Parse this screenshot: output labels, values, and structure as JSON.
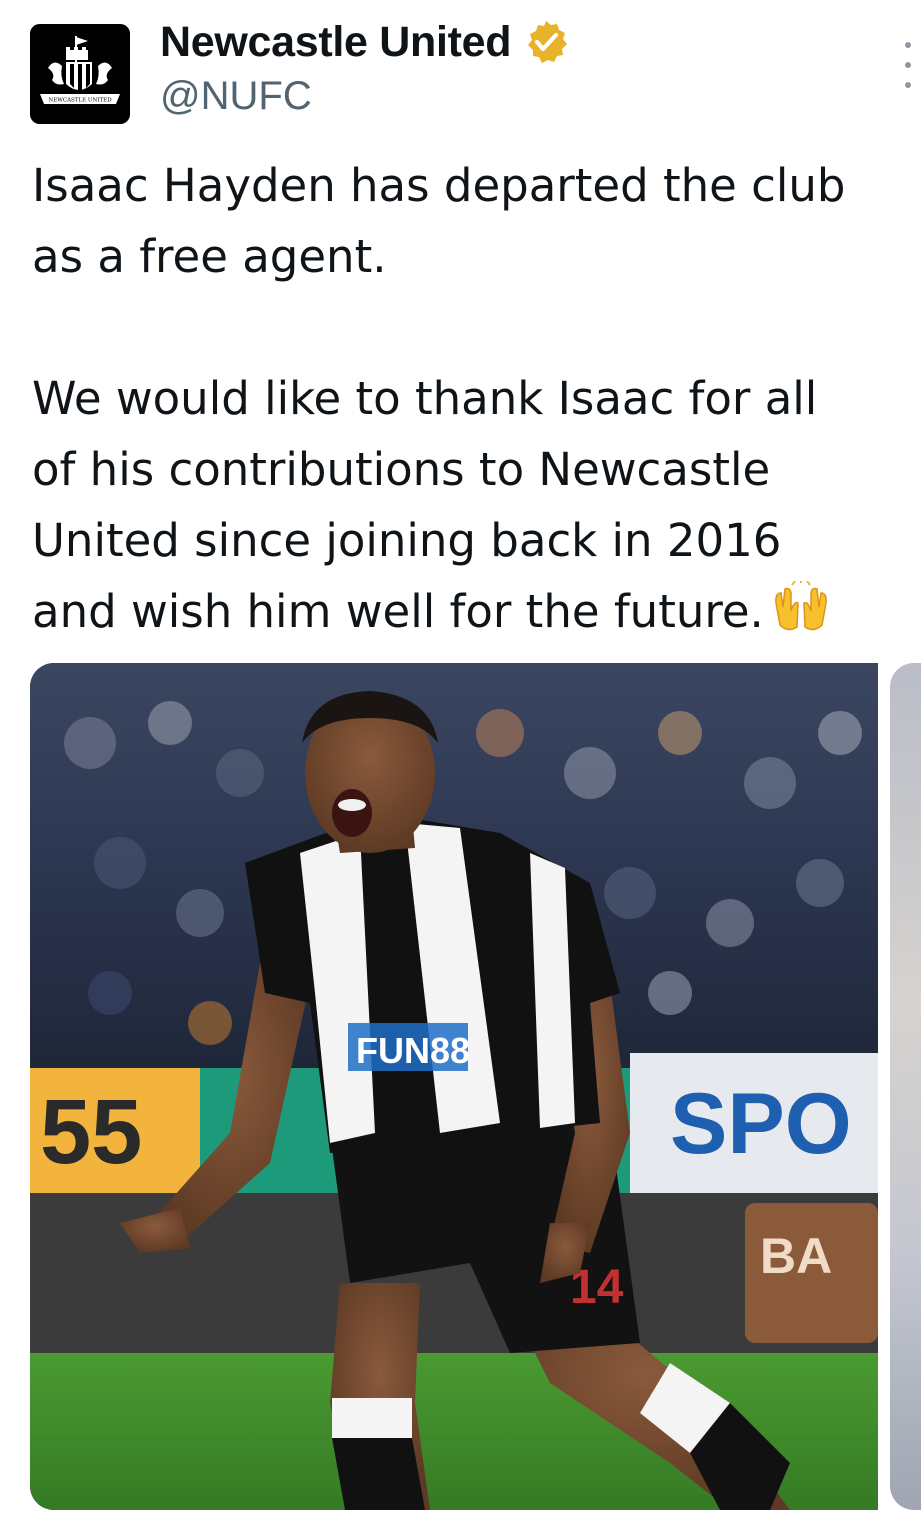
{
  "account": {
    "display_name": "Newcastle United",
    "handle": "@NUFC",
    "verified_badge_color": "#e8b22a",
    "avatar_icon": "nufc-crest-icon",
    "avatar_crest_text": "NEWCASTLE UNITED"
  },
  "tweet": {
    "lines": [
      "Isaac Hayden has departed the club",
      "as a free agent.",
      "",
      "We would like to thank Isaac for all",
      "of his contributions to Newcastle",
      "United since joining back in 2016",
      "and wish him well for the future."
    ],
    "emoji": "raising-hands-emoji"
  },
  "media": {
    "photo_description_icon": "player-celebration-photo",
    "kit_sponsor": "FUN88",
    "shirt_number": "14",
    "board_left": "55",
    "board_right": "SPO",
    "board_lower": "BA"
  },
  "colors": {
    "text": "#0f1419",
    "secondary": "#536471",
    "pitch": "#3f8a2b"
  }
}
